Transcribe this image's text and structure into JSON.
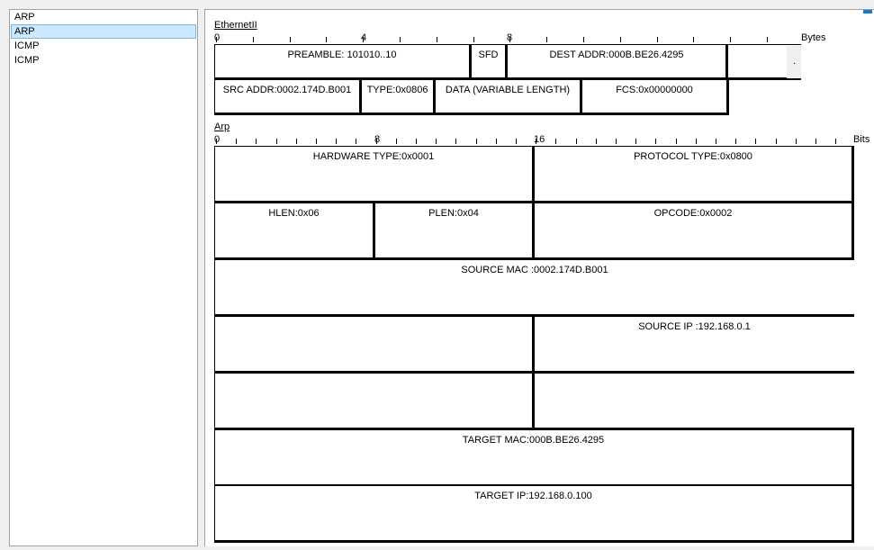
{
  "packet_list": {
    "items": [
      {
        "label": "ARP",
        "selected": false
      },
      {
        "label": "ARP",
        "selected": true
      },
      {
        "label": "ICMP",
        "selected": false
      },
      {
        "label": "ICMP",
        "selected": false
      }
    ]
  },
  "ethernet": {
    "title": "EthernetII",
    "unit": "Bytes",
    "ruler": {
      "n0": "0",
      "n4": "4",
      "n8": "8"
    },
    "preamble": "PREAMBLE: 101010..10",
    "sfd": "SFD",
    "dest": "DEST ADDR:000B.BE26.4295",
    "extra": ".",
    "src": "SRC ADDR:0002.174D.B001",
    "type": "TYPE:0x0806",
    "data": "DATA (VARIABLE LENGTH)",
    "fcs": "FCS:0x00000000"
  },
  "arp": {
    "title": "Arp",
    "unit": "Bits",
    "ruler": {
      "n0": "0",
      "n8": "8",
      "n16": "16"
    },
    "hw_type": "HARDWARE TYPE:0x0001",
    "proto_type": "PROTOCOL TYPE:0x0800",
    "hlen": "HLEN:0x06",
    "plen": "PLEN:0x04",
    "opcode": "OPCODE:0x0002",
    "src_mac": "SOURCE MAC :0002.174D.B001",
    "src_ip": "SOURCE IP :192.168.0.1",
    "target_mac": "TARGET MAC:000B.BE26.4295",
    "target_ip": "TARGET IP:192.168.0.100"
  },
  "colors": {
    "selection": "#cce8ff",
    "accent": "#1479d2"
  }
}
